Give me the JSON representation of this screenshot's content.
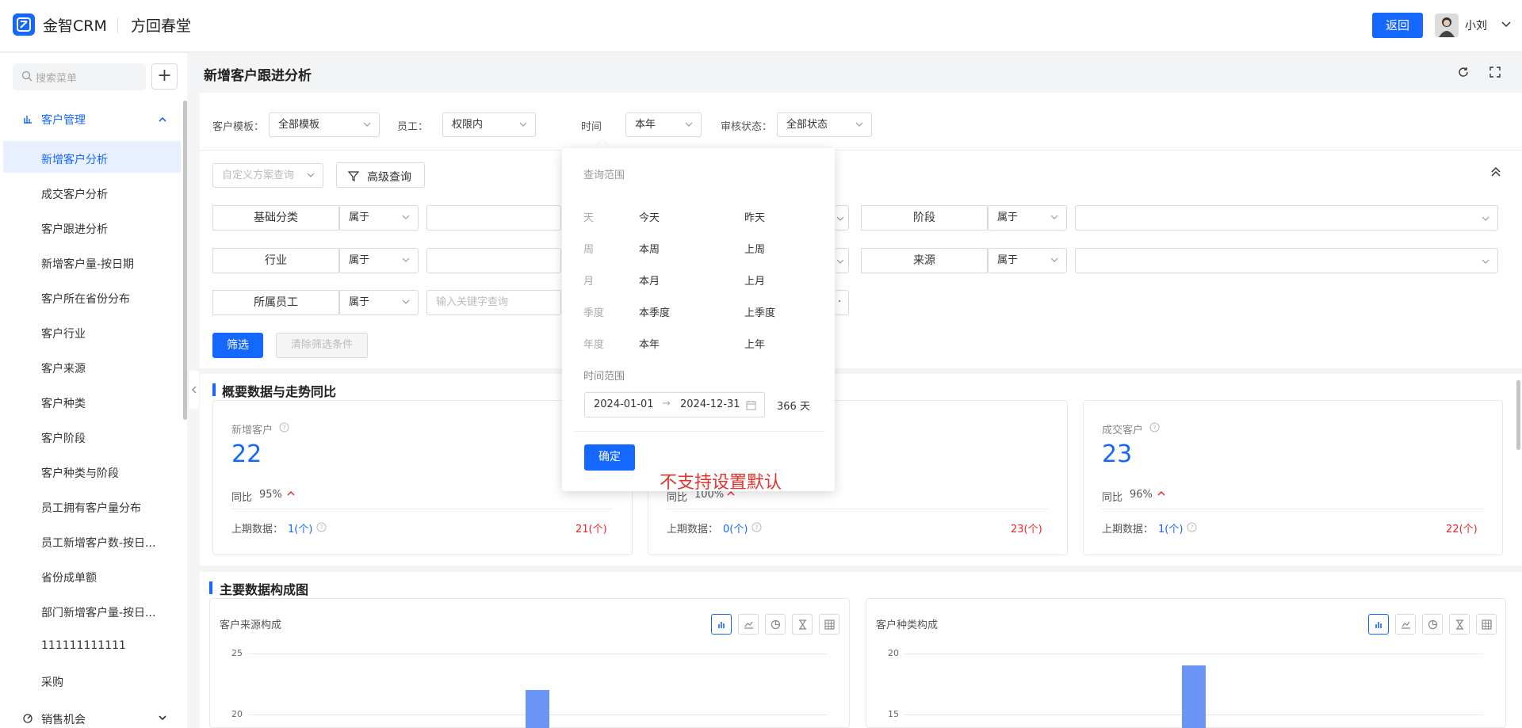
{
  "header": {
    "app_name": "金智CRM",
    "org_name": "方回春堂",
    "back_label": "返回",
    "user_name": "小刘"
  },
  "sidebar": {
    "search_placeholder": "搜索菜单",
    "add_label": "+",
    "group_label": "客户管理",
    "items": [
      "新增客户分析",
      "成交客户分析",
      "客户跟进分析",
      "新增客户量-按日期",
      "客户所在省份分布",
      "客户行业",
      "客户来源",
      "客户种类",
      "客户阶段",
      "客户种类与阶段",
      "员工拥有客户量分布",
      "员工新增客户数-按日...",
      "省份成单额",
      "部门新增客户量-按日...",
      "111111111111",
      "采购"
    ],
    "active_index": 0,
    "next_group_label": "销售机会"
  },
  "page": {
    "title": "新增客户跟进分析"
  },
  "filters": {
    "template_label": "客户模板：",
    "template_value": "全部模板",
    "staff_label": "员工：",
    "staff_value": "权限内",
    "time_label": "时间",
    "time_value": "本年",
    "audit_label": "审核状态：",
    "audit_value": "全部状态",
    "custom_query_placeholder": "自定义方案查询",
    "advanced_query_label": "高级查询",
    "rows": [
      {
        "field": "基础分类",
        "op": "属于"
      },
      {
        "field": "行业",
        "op": "属于"
      },
      {
        "field": "所属员工",
        "op": "属于",
        "placeholder": "输入关键字查询"
      }
    ],
    "right_rows": [
      {
        "field": "阶段",
        "op": "属于"
      },
      {
        "field": "来源",
        "op": "属于"
      }
    ],
    "filter_btn": "筛选",
    "clear_btn": "清除筛选条件"
  },
  "time_popup": {
    "title": "查询范围",
    "rows": [
      {
        "cat": "天",
        "a": "今天",
        "b": "昨天"
      },
      {
        "cat": "周",
        "a": "本周",
        "b": "上周"
      },
      {
        "cat": "月",
        "a": "本月",
        "b": "上月"
      },
      {
        "cat": "季度",
        "a": "本季度",
        "b": "上季度"
      },
      {
        "cat": "年度",
        "a": "本年",
        "b": "上年"
      }
    ],
    "range_label": "时间范围",
    "start_date": "2024-01-01",
    "end_date": "2024-12-31",
    "days": "366 天",
    "confirm": "确定",
    "note": "不支持设置默认"
  },
  "overview": {
    "title": "概要数据与走势同比",
    "cards": [
      {
        "label": "新增客户",
        "value": "22",
        "yoy_label": "同比",
        "yoy": "95%",
        "prev_label": "上期数据：",
        "prev": "1(个)",
        "diff": "21(个)"
      },
      {
        "label": "",
        "value": "",
        "yoy_label": "同比",
        "yoy": "100%",
        "prev_label": "上期数据：",
        "prev": "0(个)",
        "diff": "23(个)"
      },
      {
        "label": "成交客户",
        "value": "23",
        "yoy_label": "同比",
        "yoy": "96%",
        "prev_label": "上期数据：",
        "prev": "1(个)",
        "diff": "22(个)"
      }
    ]
  },
  "charts_section": {
    "title": "主要数据构成图",
    "left": {
      "title": "客户来源构成",
      "ticks": [
        "25",
        "20"
      ]
    },
    "right": {
      "title": "客户种类构成",
      "ticks": [
        "20",
        "15"
      ]
    },
    "icons": [
      "bar-chart-icon",
      "line-chart-icon",
      "pie-chart-icon",
      "funnel-icon",
      "table-icon"
    ]
  },
  "chart_data": [
    {
      "type": "bar",
      "title": "客户来源构成",
      "ylim": [
        0,
        25
      ],
      "visible_bar_values": [
        22
      ]
    },
    {
      "type": "bar",
      "title": "客户种类构成",
      "ylim": [
        0,
        20
      ],
      "visible_bar_values": [
        19
      ]
    }
  ],
  "colors": {
    "accent": "#1467ff",
    "bar": "#6b96f8",
    "up": "#f5222d",
    "note": "#e5322d"
  }
}
